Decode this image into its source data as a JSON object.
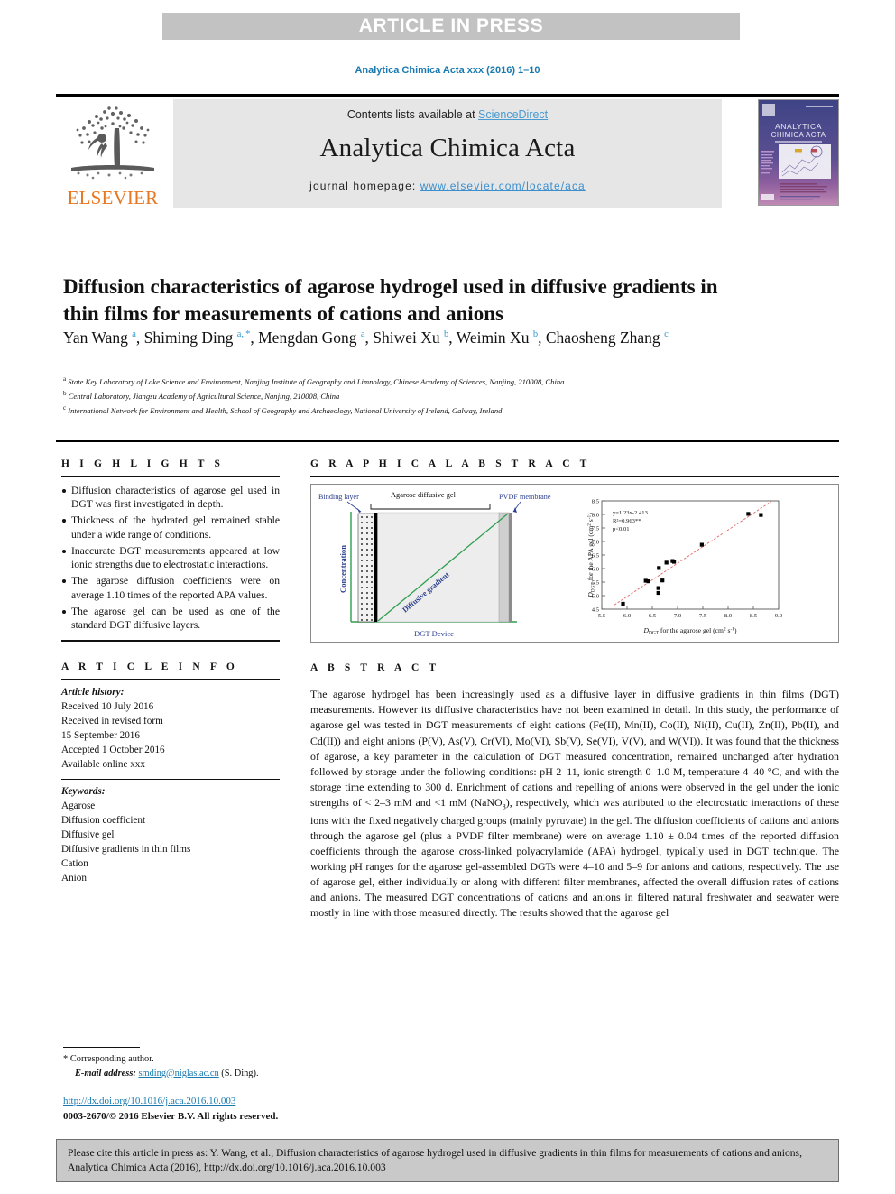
{
  "banner": {
    "label": "ARTICLE IN PRESS"
  },
  "running_head": "Analytica Chimica Acta xxx (2016) 1–10",
  "masthead": {
    "contents_prefix": "Contents lists available at ",
    "sciencedirect": "ScienceDirect",
    "journal_name": "Analytica Chimica Acta",
    "homepage_prefix": "journal homepage: ",
    "homepage_url": "www.elsevier.com/locate/aca",
    "publisher_wordmark": "ELSEVIER",
    "cover_title_line1": "ANALYTICA",
    "cover_title_line2": "CHIMICA ACTA"
  },
  "article": {
    "title": "Diffusion characteristics of agarose hydrogel used in diffusive gradients in thin films for measurements of cations and anions",
    "authors_html": "Yan Wang <sup>a</sup>, Shiming Ding <sup>a, *</sup>, Mengdan Gong <sup>a</sup>, Shiwei Xu <sup>b</sup>, Weimin Xu <sup>b</sup>, Chaosheng Zhang <sup>c</sup>",
    "affiliations": [
      {
        "marker": "a",
        "text": "State Key Laboratory of Lake Science and Environment, Nanjing Institute of Geography and Limnology, Chinese Academy of Sciences, Nanjing, 210008, China"
      },
      {
        "marker": "b",
        "text": "Central Laboratory, Jiangsu Academy of Agricultural Science, Nanjing, 210008, China"
      },
      {
        "marker": "c",
        "text": "International Network for Environment and Health, School of Geography and Archaeology, National University of Ireland, Galway, Ireland"
      }
    ]
  },
  "highlights": {
    "heading": "HIGHLIGHTS",
    "items": [
      "Diffusion characteristics of agarose gel used in DGT was first investigated in depth.",
      "Thickness of the hydrated gel remained stable under a wide range of conditions.",
      "Inaccurate DGT measurements appeared at low ionic strengths due to electrostatic interactions.",
      "The agarose diffusion coefficients were on average 1.10 times of the reported APA values.",
      "The agarose gel can be used as one of the standard DGT diffusive layers."
    ]
  },
  "graphical_abstract": {
    "heading": "GRAPHICAL ABSTRACT",
    "diagram": {
      "binding_layer_label": "Binding layer",
      "diffusive_gel_label": "Agarose diffusive gel",
      "membrane_label": "PVDF membrane",
      "y_axis_label": "Concentration",
      "gradient_label": "Diffusive gradient",
      "caption": "DGT Device"
    }
  },
  "chart_data": {
    "type": "scatter",
    "title": "",
    "xlabel": "D_DGT for the agarose gel (cm² s⁻¹)",
    "ylabel": "D_DGT for the APA gel (cm² s⁻¹)",
    "xlabel_parts": {
      "italic": "D",
      "sub": "DGT",
      "rest": " for the agarose gel (cm",
      "sup1": "2",
      "mid": " s",
      "sup2": "-1",
      "close": ")"
    },
    "ylabel_parts": {
      "italic": "D",
      "sub": "DGT",
      "rest": " for the APA gel (cm",
      "sup1": "2",
      "mid": " s",
      "sup2": "-1",
      "close": ")"
    },
    "xlim": [
      5.5,
      9.0
    ],
    "ylim": [
      4.5,
      8.5
    ],
    "xticks": [
      5.5,
      6.0,
      6.5,
      7.0,
      7.5,
      8.0,
      8.5,
      9.0
    ],
    "yticks": [
      4.5,
      5.0,
      5.5,
      6.0,
      6.5,
      7.0,
      7.5,
      8.0,
      8.5
    ],
    "grid": false,
    "legend": "none",
    "annotations": [
      "y=1.23x-2.413",
      "R²=0.963**",
      "p<0.01"
    ],
    "trendline": {
      "slope": 1.23,
      "intercept": -2.413,
      "color": "#e06666",
      "style": "dashed"
    },
    "marker_color": "#000000",
    "points": [
      {
        "x": 5.92,
        "y": 4.7
      },
      {
        "x": 6.37,
        "y": 5.55
      },
      {
        "x": 6.42,
        "y": 5.53
      },
      {
        "x": 6.62,
        "y": 5.28
      },
      {
        "x": 6.62,
        "y": 5.1
      },
      {
        "x": 6.63,
        "y": 6.02
      },
      {
        "x": 6.7,
        "y": 5.56
      },
      {
        "x": 6.78,
        "y": 6.22
      },
      {
        "x": 6.9,
        "y": 6.28
      },
      {
        "x": 6.93,
        "y": 6.25
      },
      {
        "x": 7.48,
        "y": 6.88
      },
      {
        "x": 8.4,
        "y": 8.02
      },
      {
        "x": 8.65,
        "y": 7.98
      }
    ]
  },
  "article_info": {
    "heading": "ARTICLE INFO",
    "history_label": "Article history:",
    "history": [
      "Received 10 July 2016",
      "Received in revised form",
      "15 September 2016",
      "Accepted 1 October 2016",
      "Available online xxx"
    ],
    "keywords_label": "Keywords:",
    "keywords": [
      "Agarose",
      "Diffusion coefficient",
      "Diffusive gel",
      "Diffusive gradients in thin films",
      "Cation",
      "Anion"
    ]
  },
  "abstract": {
    "heading": "ABSTRACT",
    "body": "The agarose hydrogel has been increasingly used as a diffusive layer in diffusive gradients in thin films (DGT) measurements. However its diffusive characteristics have not been examined in detail. In this study, the performance of agarose gel was tested in DGT measurements of eight cations (Fe(II), Mn(II), Co(II), Ni(II), Cu(II), Zn(II), Pb(II), and Cd(II)) and eight anions (P(V), As(V), Cr(VI), Mo(VI), Sb(V), Se(VI), V(V), and W(VI)). It was found that the thickness of agarose, a key parameter in the calculation of DGT measured concentration, remained unchanged after hydration followed by storage under the following conditions: pH 2–11, ionic strength 0–1.0 M, temperature 4–40 °C, and with the storage time extending to 300 d. Enrichment of cations and repelling of anions were observed in the gel under the ionic strengths of < 2–3 mM and <1 mM (NaNO3), respectively, which was attributed to the electrostatic interactions of these ions with the fixed negatively charged groups (mainly pyruvate) in the gel. The diffusion coefficients of cations and anions through the agarose gel (plus a PVDF filter membrane) were on average 1.10 ± 0.04 times of the reported diffusion coefficients through the agarose cross-linked polyacrylamide (APA) hydrogel, typically used in DGT technique. The working pH ranges for the agarose gel-assembled DGTs were 4–10 and 5–9 for anions and cations, respectively. The use of agarose gel, either individually or along with different filter membranes, affected the overall diffusion rates of cations and anions. The measured DGT concentrations of cations and anions in filtered natural freshwater and seawater were mostly in line with those measured directly. The results showed that the agarose gel"
  },
  "footnotes": {
    "corresponding_marker": "*",
    "corresponding_text": "Corresponding author.",
    "email_label": "E-mail address:",
    "email": "smding@niglas.ac.cn",
    "email_suffix": "(S. Ding).",
    "doi_url": "http://dx.doi.org/10.1016/j.aca.2016.10.003",
    "copyright": "0003-2670/© 2016 Elsevier B.V. All rights reserved."
  },
  "cite_box": {
    "text": "Please cite this article in press as: Y. Wang, et al., Diffusion characteristics of agarose hydrogel used in diffusive gradients in thin films for measurements of cations and anions, Analytica Chimica Acta (2016), http://dx.doi.org/10.1016/j.aca.2016.10.003"
  },
  "colors": {
    "link": "#1a7ab0",
    "sciencedirect": "#4a9bd1",
    "elsevier_orange": "#e87722",
    "banner_bg": "#c2c2c2",
    "diagram_blue": "#2b3f8f",
    "diagram_green": "#2e9e4f"
  }
}
